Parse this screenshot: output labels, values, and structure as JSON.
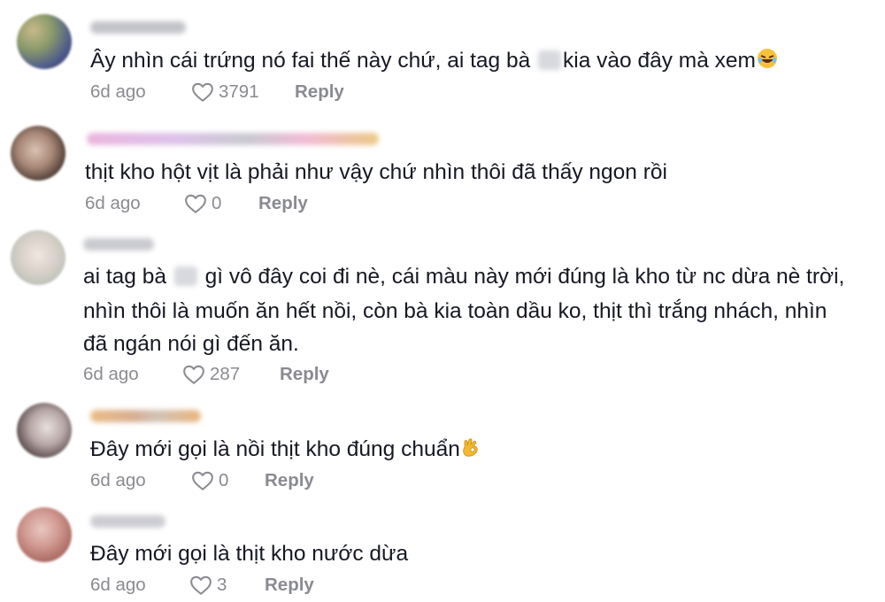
{
  "comments": [
    {
      "username": "",
      "text_a": "Ây nhìn cái trứng nó fai thế này chứ, ai tag bà ",
      "text_b": "kia vào đây mà xem",
      "emoji": "rolling-on-floor-laughing",
      "time": "6d ago",
      "likes": "3791",
      "reply": "Reply"
    },
    {
      "username": "",
      "text": "thịt kho hột vịt là phải như vậy chứ nhìn thôi đã thấy ngon rồi",
      "time": "6d ago",
      "likes": "0",
      "reply": "Reply"
    },
    {
      "username": "",
      "line1_a": "ai tag bà ",
      "line1_b": "gì vô đây coi đi nè, cái màu này mới đúng là kho từ nc dừa nè trời,",
      "line2": "nhìn thôi là muốn ăn hết nồi, còn bà kia toàn dầu ko, thịt thì trắng nhách, nhìn",
      "line3": "đã ngán nói gì đến ăn.",
      "time": "6d ago",
      "likes": "287",
      "reply": "Reply"
    },
    {
      "username": "",
      "text": "Đây mới gọi là nồi thịt kho đúng chuẩn",
      "emoji": "ok-hand",
      "time": "6d ago",
      "likes": "0",
      "reply": "Reply"
    },
    {
      "username": "",
      "text": "Đây mới gọi là thịt kho nước dừa",
      "time": "6d ago",
      "likes": "3",
      "reply": "Reply"
    }
  ],
  "icons": {
    "like": "heart-outline-icon"
  },
  "colors": {
    "text": "#161823",
    "meta": "#8a8b91"
  }
}
